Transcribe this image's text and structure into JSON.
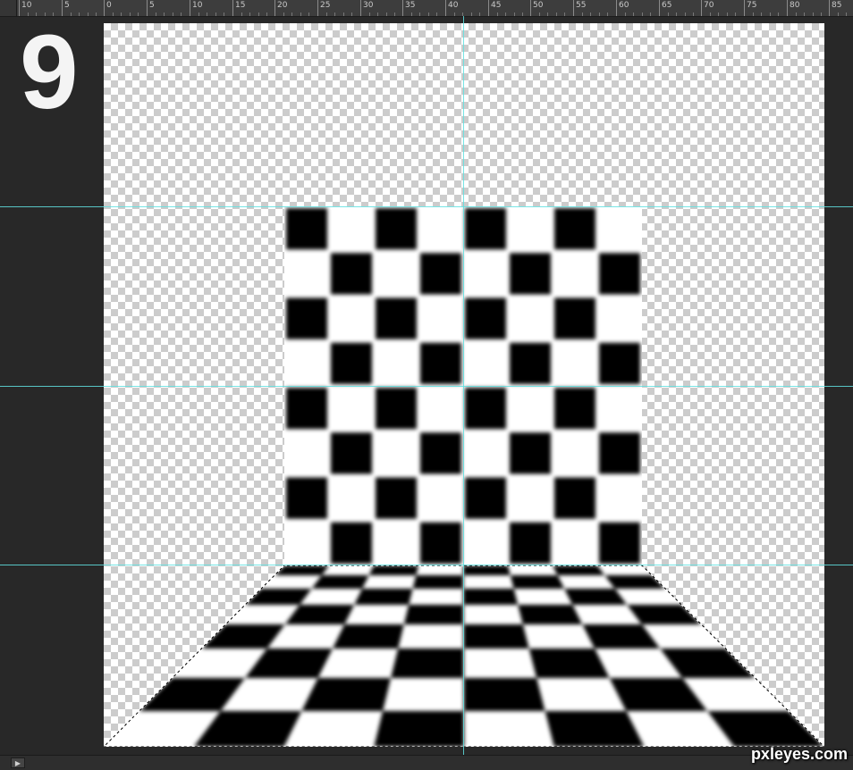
{
  "ruler": {
    "labels": [
      "10",
      "5",
      "0",
      "5",
      "10",
      "15",
      "20",
      "25",
      "30",
      "35",
      "40",
      "45",
      "50",
      "55",
      "60",
      "65",
      "70",
      "75",
      "80",
      "85"
    ]
  },
  "step_number": "9",
  "watermark": "pxleyes.com",
  "statusbar": {
    "arrow_icon": "play-right-icon"
  },
  "artwork": {
    "wall_grid": {
      "columns": 8,
      "rows": 8
    },
    "floor_grid": {
      "columns": 8,
      "rows": 8
    },
    "guides": {
      "horizontal_count": 3,
      "vertical_count": 1
    }
  },
  "colors": {
    "workspace": "#282828",
    "guide": "#5fe0e0",
    "tile_dark": "#000000",
    "tile_light": "#ffffff",
    "transparency_checker": "#cccccc"
  }
}
